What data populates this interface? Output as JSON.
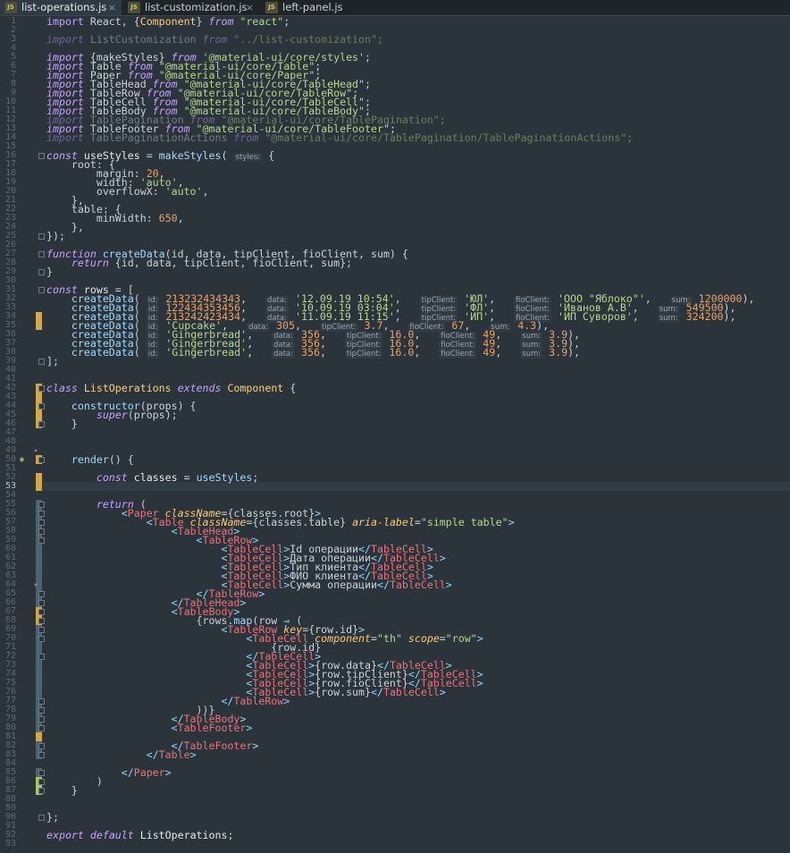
{
  "tabs": [
    {
      "label": "list-operations.js",
      "active": true
    },
    {
      "label": "list-customization.js",
      "active": false
    },
    {
      "label": "left-panel.js",
      "active": false
    }
  ],
  "close_glyph": "×",
  "js_badge": "JS",
  "current_line": 53,
  "lines": [
    {
      "n": "1",
      "html": "<span class='kw2'>import</span> React, {<span class='cls'>Component</span>} <span class='kw'>from</span> <span class='str'>\"react\"</span>;"
    },
    {
      "n": "2",
      "html": ""
    },
    {
      "n": "3",
      "dim": true,
      "html": "<span class='kw'>import</span> ListCustomization <span class='kw'>from</span> <span class='str'>\"../list-customization\"</span>;"
    },
    {
      "n": "4",
      "html": ""
    },
    {
      "n": "5",
      "html": "<span class='kw'>import</span> {makeStyles} <span class='kw'>from</span> <span class='str'>'@material-ui/core/styles'</span>;"
    },
    {
      "n": "6",
      "html": "<span class='kw'>import</span> Table <span class='kw'>from</span> <span class='str'>\"@material-ui/core/Table\"</span>;"
    },
    {
      "n": "7",
      "html": "<span class='kw'>import</span> Paper <span class='kw'>from</span> <span class='str'>\"@material-ui/core/Paper\"</span>;"
    },
    {
      "n": "8",
      "html": "<span class='kw'>import</span> TableHead <span class='kw'>from</span> <span class='str'>\"@material-ui/core/TableHead\"</span>;"
    },
    {
      "n": "9",
      "html": "<span class='kw'>import</span> TableRow <span class='kw'>from</span> <span class='str'>\"@material-ui/core/TableRow\"</span>;"
    },
    {
      "n": "10",
      "html": "<span class='kw'>import</span> TableCell <span class='kw'>from</span> <span class='str'>\"@material-ui/core/TableCell\"</span>;"
    },
    {
      "n": "11",
      "html": "<span class='kw'>import</span> TableBody <span class='kw'>from</span> <span class='str'>\"@material-ui/core/TableBody\"</span>;"
    },
    {
      "n": "12",
      "dim": true,
      "html": "<span class='kw'>import</span> TablePagination <span class='kw'>from</span> <span class='str'>\"@material-ui/core/TablePagination\"</span>;"
    },
    {
      "n": "13",
      "html": "<span class='kw'>import</span> TableFooter <span class='kw'>from</span> <span class='str'>\"@material-ui/core/TableFooter\"</span>;"
    },
    {
      "n": "14",
      "dim": true,
      "html": "<span class='kw'>import</span> TablePaginationActions <span class='kw'>from</span> <span class='str'>\"@material-ui/core/TablePagination/TablePaginationActions\"</span>;"
    },
    {
      "n": "15",
      "html": ""
    },
    {
      "n": "16",
      "html": "<span class='kw'>const</span> <span class='prop'>useStyles</span> = <span class='fn'>makeStyles</span>( <span class='hint'>styles:</span> {"
    },
    {
      "n": "17",
      "html": "    root: {"
    },
    {
      "n": "18",
      "html": "        margin: <span class='num'>20</span>,"
    },
    {
      "n": "19",
      "html": "        width: <span class='str'>'auto'</span>,"
    },
    {
      "n": "20",
      "html": "        overflowX: <span class='str'>'auto'</span>,"
    },
    {
      "n": "21",
      "html": "    },"
    },
    {
      "n": "22",
      "html": "    table: {"
    },
    {
      "n": "23",
      "html": "        minWidth: <span class='num'>650</span>,"
    },
    {
      "n": "24",
      "html": "    },"
    },
    {
      "n": "25",
      "html": "});"
    },
    {
      "n": "26",
      "html": ""
    },
    {
      "n": "27",
      "html": "<span class='kw'>function</span> <span class='fn'>createData</span>(id, data, tipClient, fioClient, sum) {"
    },
    {
      "n": "28",
      "html": "    <span class='kw'>return</span> {id, data, tipClient, fioClient, sum};"
    },
    {
      "n": "29",
      "html": "}"
    },
    {
      "n": "30",
      "html": ""
    },
    {
      "n": "31",
      "html": "<span class='kw'>const</span> <span class='prop'>rows</span> = ["
    },
    {
      "n": "32",
      "html": "    <span class='fn'>createData</span>( <span class='hint'>id:</span> <span class='num'>21323243434З</span>,   <span class='hint'>data:</span> <span class='str'>'12.09.19 10:54'</span>,   <span class='hint'>tipClient:</span> <span class='str'>'ЮЛ'</span>,   <span class='hint'>fioClient:</span> <span class='str'>'ООО \"Яблоко\"'</span>,   <span class='hint'>sum:</span> <span class='num'>1200000</span>),"
    },
    {
      "n": "33",
      "html": "    <span class='fn'>createData</span>( <span class='hint'>id:</span> <span class='num'>122434353456</span>,   <span class='hint'>data:</span> <span class='str'>'10.09.19 03:04'</span>,   <span class='hint'>tipClient:</span> <span class='str'>'ФЛ'</span>,   <span class='hint'>fioClient:</span> <span class='str'>'Иванов А.В'</span>,   <span class='hint'>sum:</span> <span class='num'>549500</span>),"
    },
    {
      "n": "34",
      "html": "    <span class='fn'>createData</span>( <span class='hint'>id:</span> <span class='num'>213242423434</span>,   <span class='hint'>data:</span> <span class='str'>'11.09.19 11:15'</span>,   <span class='hint'>tipClient:</span> <span class='str'>'ИП'</span>,   <span class='hint'>fioClient:</span> <span class='str'>'ИП Суворов'</span>,   <span class='hint'>sum:</span> <span class='num'>324200</span>),"
    },
    {
      "n": "35",
      "html": "    <span class='fn'>createData</span>( <span class='hint'>id:</span> <span class='str'>'Cupcake'</span>,   <span class='hint'>data:</span> <span class='num'>305</span>,   <span class='hint'>tipClient:</span> <span class='num'>3.7</span>,   <span class='hint'>fioClient:</span> <span class='num'>67</span>,   <span class='hint'>sum:</span> <span class='num'>4.3</span>),"
    },
    {
      "n": "36",
      "html": "    <span class='fn'>createData</span>( <span class='hint'>id:</span> <span class='str'>'Gingerbread'</span>,   <span class='hint'>data:</span> <span class='num'>356</span>,   <span class='hint'>tipClient:</span> <span class='num'>16.0</span>,   <span class='hint'>fioClient:</span> <span class='num'>49</span>,   <span class='hint'>sum:</span> <span class='num'>3.9</span>),"
    },
    {
      "n": "37",
      "html": "    <span class='fn'>createData</span>( <span class='hint'>id:</span> <span class='str'>'Gingerbread'</span>,   <span class='hint'>data:</span> <span class='num'>356</span>,   <span class='hint'>tipClient:</span> <span class='num'>16.0</span>,   <span class='hint'>fioClient:</span> <span class='num'>49</span>,   <span class='hint'>sum:</span> <span class='num'>3.9</span>),"
    },
    {
      "n": "38",
      "html": "    <span class='fn'>createData</span>( <span class='hint'>id:</span> <span class='str'>'Gingerbread'</span>,   <span class='hint'>data:</span> <span class='num'>356</span>,   <span class='hint'>tipClient:</span> <span class='num'>16.0</span>,   <span class='hint'>fioClient:</span> <span class='num'>49</span>,   <span class='hint'>sum:</span> <span class='num'>3.9</span>),"
    },
    {
      "n": "39",
      "html": "];"
    },
    {
      "n": "40",
      "html": ""
    },
    {
      "n": "41",
      "html": ""
    },
    {
      "n": "42",
      "html": "<span class='kw'>class</span> <span class='cls'>ListOperations</span> <span class='kw'>extends</span> <span class='cls'>Component</span> {"
    },
    {
      "n": "43",
      "html": ""
    },
    {
      "n": "44",
      "html": "    <span class='fn'>constructor</span>(props) {"
    },
    {
      "n": "45",
      "html": "        <span class='kw'>super</span>(props);"
    },
    {
      "n": "46",
      "html": "    }"
    },
    {
      "n": "47",
      "html": ""
    },
    {
      "n": "48",
      "html": ""
    },
    {
      "n": "49",
      "html": ""
    },
    {
      "n": "50",
      "html": "    <span class='fn'>render</span>() {"
    },
    {
      "n": "51",
      "html": ""
    },
    {
      "n": "52",
      "html": "        <span class='kw'>const</span> <span class='prop'>classes</span> = <span class='fn'>useStyles</span>;"
    },
    {
      "n": "53",
      "html": ""
    },
    {
      "n": "54",
      "html": ""
    },
    {
      "n": "55",
      "html": "        <span class='kw'>return</span> ("
    },
    {
      "n": "56",
      "html": "            <span class='punct'>&lt;</span><span class='tag'>Paper</span> <span class='attr'>className</span>={classes.root}<span class='punct'>&gt;</span>"
    },
    {
      "n": "57",
      "html": "                <span class='punct'>&lt;</span><span class='tag'>Table</span> <span class='attr'>className</span>={classes.table} <span class='attr'>aria-label</span>=<span class='str'>\"simple table\"</span><span class='punct'>&gt;</span>"
    },
    {
      "n": "58",
      "html": "                    <span class='punct'>&lt;</span><span class='tag'>TableHead</span><span class='punct'>&gt;</span>"
    },
    {
      "n": "59",
      "html": "                        <span class='punct'>&lt;</span><span class='tag'>TableRow</span><span class='punct'>&gt;</span>"
    },
    {
      "n": "60",
      "html": "                            <span class='punct'>&lt;</span><span class='tag'>TableCell</span><span class='punct'>&gt;</span>Id операции<span class='punct'>&lt;/</span><span class='tag'>TableCell</span><span class='punct'>&gt;</span>"
    },
    {
      "n": "61",
      "html": "                            <span class='punct'>&lt;</span><span class='tag'>TableCell</span><span class='punct'>&gt;</span>Дата операции<span class='punct'>&lt;/</span><span class='tag'>TableCell</span><span class='punct'>&gt;</span>"
    },
    {
      "n": "62",
      "html": "                            <span class='punct'>&lt;</span><span class='tag'>TableCell</span><span class='punct'>&gt;</span>Тип клиента<span class='punct'>&lt;/</span><span class='tag'>TableCell</span><span class='punct'>&gt;</span>"
    },
    {
      "n": "63",
      "html": "                            <span class='punct'>&lt;</span><span class='tag'>TableCell</span><span class='punct'>&gt;</span>ФИО клиента<span class='punct'>&lt;/</span><span class='tag'>TableCell</span><span class='punct'>&gt;</span>"
    },
    {
      "n": "64",
      "html": "                            <span class='punct'>&lt;</span><span class='tag'>TableCell</span><span class='punct'>&gt;</span>Сумма операции<span class='punct'>&lt;/</span><span class='tag'>TableCell</span><span class='punct'>&gt;</span>"
    },
    {
      "n": "65",
      "html": "                        <span class='punct'>&lt;/</span><span class='tag'>TableRow</span><span class='punct'>&gt;</span>"
    },
    {
      "n": "66",
      "html": "                    <span class='punct'>&lt;/</span><span class='tag'>TableHead</span><span class='punct'>&gt;</span>"
    },
    {
      "n": "67",
      "html": "                    <span class='punct'>&lt;</span><span class='tag'>TableBody</span><span class='punct'>&gt;</span>"
    },
    {
      "n": "68",
      "html": "                        {rows.<span class='fn'>map</span>(row <span class='punct'>⇒</span> ("
    },
    {
      "n": "69",
      "html": "                            <span class='punct'>&lt;</span><span class='tag'>TableRow</span> <span class='attr'>key</span>={row.id}<span class='punct'>&gt;</span>"
    },
    {
      "n": "70",
      "html": "                                <span class='punct'>&lt;</span><span class='tag'>TableCell</span> <span class='attr'>component</span>=<span class='str'>\"th\"</span> <span class='attr'>scope</span>=<span class='str'>\"row\"</span><span class='punct'>&gt;</span>"
    },
    {
      "n": "71",
      "html": "                                    {row.id}"
    },
    {
      "n": "72",
      "html": "                                <span class='punct'>&lt;/</span><span class='tag'>TableCell</span><span class='punct'>&gt;</span>"
    },
    {
      "n": "73",
      "html": "                                <span class='punct'>&lt;</span><span class='tag'>TableCell</span><span class='punct'>&gt;</span>{row.data}<span class='punct'>&lt;/</span><span class='tag'>TableCell</span><span class='punct'>&gt;</span>"
    },
    {
      "n": "74",
      "html": "                                <span class='punct'>&lt;</span><span class='tag'>TableCell</span><span class='punct'>&gt;</span>{row.tipClient}<span class='punct'>&lt;/</span><span class='tag'>TableCell</span><span class='punct'>&gt;</span>"
    },
    {
      "n": "75",
      "html": "                                <span class='punct'>&lt;</span><span class='tag'>TableCell</span><span class='punct'>&gt;</span>{row.fioClient}<span class='punct'>&lt;/</span><span class='tag'>TableCell</span><span class='punct'>&gt;</span>"
    },
    {
      "n": "76",
      "html": "                                <span class='punct'>&lt;</span><span class='tag'>TableCell</span><span class='punct'>&gt;</span>{row.sum}<span class='punct'>&lt;/</span><span class='tag'>TableCell</span><span class='punct'>&gt;</span>"
    },
    {
      "n": "77",
      "html": "                            <span class='punct'>&lt;/</span><span class='tag'>TableRow</span><span class='punct'>&gt;</span>"
    },
    {
      "n": "78",
      "html": "                        ))}"
    },
    {
      "n": "79",
      "html": "                    <span class='punct'>&lt;/</span><span class='tag'>TableBody</span><span class='punct'>&gt;</span>"
    },
    {
      "n": "80",
      "html": "                    <span class='punct'>&lt;</span><span class='tag'>TableFooter</span><span class='punct'>&gt;</span>"
    },
    {
      "n": "81",
      "html": ""
    },
    {
      "n": "82",
      "html": "                    <span class='punct'>&lt;/</span><span class='tag'>TableFooter</span><span class='punct'>&gt;</span>"
    },
    {
      "n": "83",
      "html": "                <span class='punct'>&lt;/</span><span class='tag'>Table</span><span class='punct'>&gt;</span>"
    },
    {
      "n": "84",
      "html": ""
    },
    {
      "n": "85",
      "html": "            <span class='punct'>&lt;/</span><span class='tag'>Paper</span><span class='punct'>&gt;</span>"
    },
    {
      "n": "86",
      "html": "        )"
    },
    {
      "n": "87",
      "html": "    }"
    },
    {
      "n": "88",
      "html": ""
    },
    {
      "n": "89",
      "html": ""
    },
    {
      "n": "90",
      "html": "};"
    },
    {
      "n": "91",
      "html": ""
    },
    {
      "n": "92",
      "html": "<span class='kw'>export</span> <span class='kw'>default</span> <span class='prop'>ListOperations</span>;"
    },
    {
      "n": "93",
      "html": ""
    }
  ]
}
